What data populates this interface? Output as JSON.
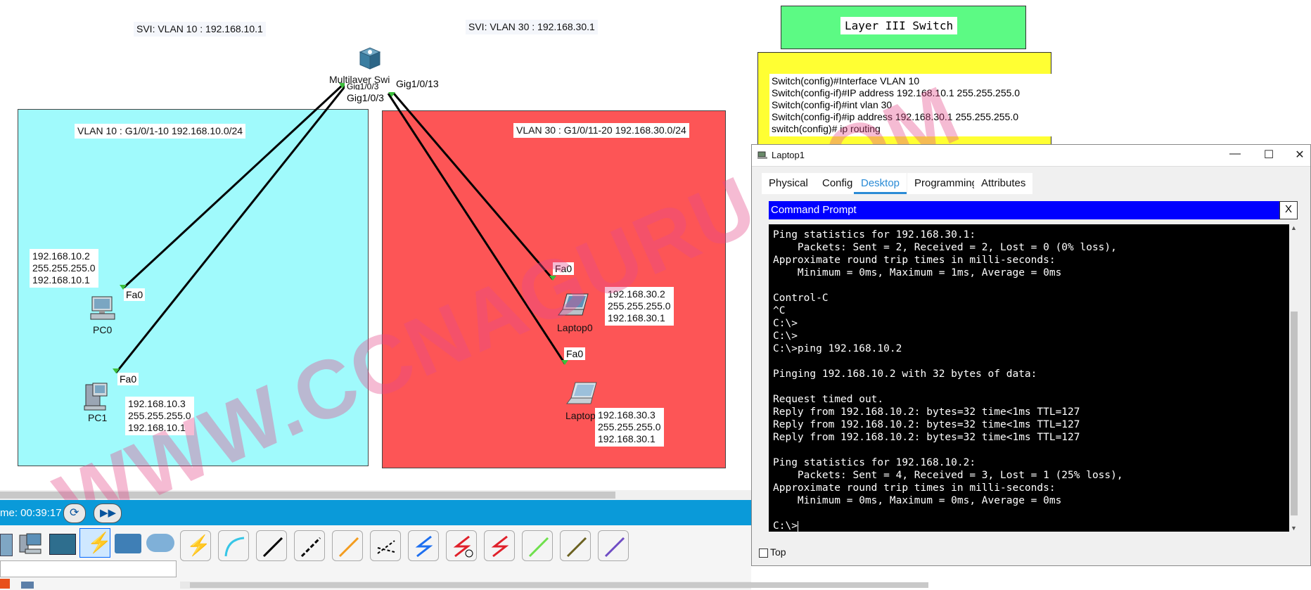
{
  "header_box": {
    "title": "Layer III Switch"
  },
  "config_box": {
    "lines": [
      "Switch(config)#Interface VLAN 10",
      "Switch(config-if)#IP address  192.168.10.1  255.255.255.0",
      "Switch(config-if)#int vlan 30",
      "Switch(config-if)#ip address  192.168.30.1  255.255.255.0",
      "switch(config)# ip routing"
    ]
  },
  "svi": {
    "vlan10": "SVI: VLAN 10 :  192.168.10.1",
    "vlan30": "SVI: VLAN 30 :  192.168.30.1"
  },
  "zones": {
    "vlan10": "VLAN 10 : G1/0/1-10     192.168.10.0/24",
    "vlan30": "VLAN 30 : G1/0/11-20     192.168.30.0/24"
  },
  "switch": {
    "name": "Multilayer Swi",
    "port_a": "Gig1/0/13",
    "port_b": "Gig1/0/3",
    "port_c": "Gig1/0/3"
  },
  "devices": {
    "pc0": {
      "name": "PC0",
      "port": "Fa0",
      "ip": "192.168.10.2",
      "mask": "255.255.255.0",
      "gw": "192.168.10.1"
    },
    "pc1": {
      "name": "PC1",
      "port": "Fa0",
      "ip": "192.168.10.3",
      "mask": "255.255.255.0",
      "gw": "192.168.10.1"
    },
    "laptop0": {
      "name": "Laptop0",
      "port": "Fa0",
      "ip": "192.168.30.2",
      "mask": "255.255.255.0",
      "gw": "192.168.30.1"
    },
    "laptop1": {
      "name": "Laptop",
      "port": "Fa0",
      "ip": "192.168.30.3",
      "mask": "255.255.255.0",
      "gw": "192.168.30.1"
    }
  },
  "watermark": "WWW.CCNAGURU.COM",
  "timebar": {
    "time": "me: 00:39:17"
  },
  "window": {
    "title": "Laptop1",
    "tabs": [
      "Physical",
      "Config",
      "Desktop",
      "Programming",
      "Attributes"
    ],
    "active_tab": "Desktop",
    "cmd_title": "Command Prompt",
    "close_x": "X",
    "top_label": "Top",
    "terminal_lines": [
      "Ping statistics for 192.168.30.1:",
      "    Packets: Sent = 2, Received = 2, Lost = 0 (0% loss),",
      "Approximate round trip times in milli-seconds:",
      "    Minimum = 0ms, Maximum = 1ms, Average = 0ms",
      "",
      "Control-C",
      "^C",
      "C:\\>",
      "C:\\>",
      "C:\\>ping 192.168.10.2",
      "",
      "Pinging 192.168.10.2 with 32 bytes of data:",
      "",
      "Request timed out.",
      "Reply from 192.168.10.2: bytes=32 time<1ms TTL=127",
      "Reply from 192.168.10.2: bytes=32 time<1ms TTL=127",
      "Reply from 192.168.10.2: bytes=32 time<1ms TTL=127",
      "",
      "Ping statistics for 192.168.10.2:",
      "    Packets: Sent = 4, Received = 3, Lost = 1 (25% loss),",
      "Approximate round trip times in milli-seconds:",
      "    Minimum = 0ms, Maximum = 0ms, Average = 0ms",
      "",
      "C:\\>"
    ]
  },
  "colors": {
    "vlan10_zone": "#a0fafc",
    "vlan30_zone": "#fd5556",
    "header_box": "#5cfa84",
    "config_box": "#ffff33",
    "timebar": "#0a9ad9",
    "cmd_bar": "#0000ff",
    "watermark": "#e64d8c"
  }
}
